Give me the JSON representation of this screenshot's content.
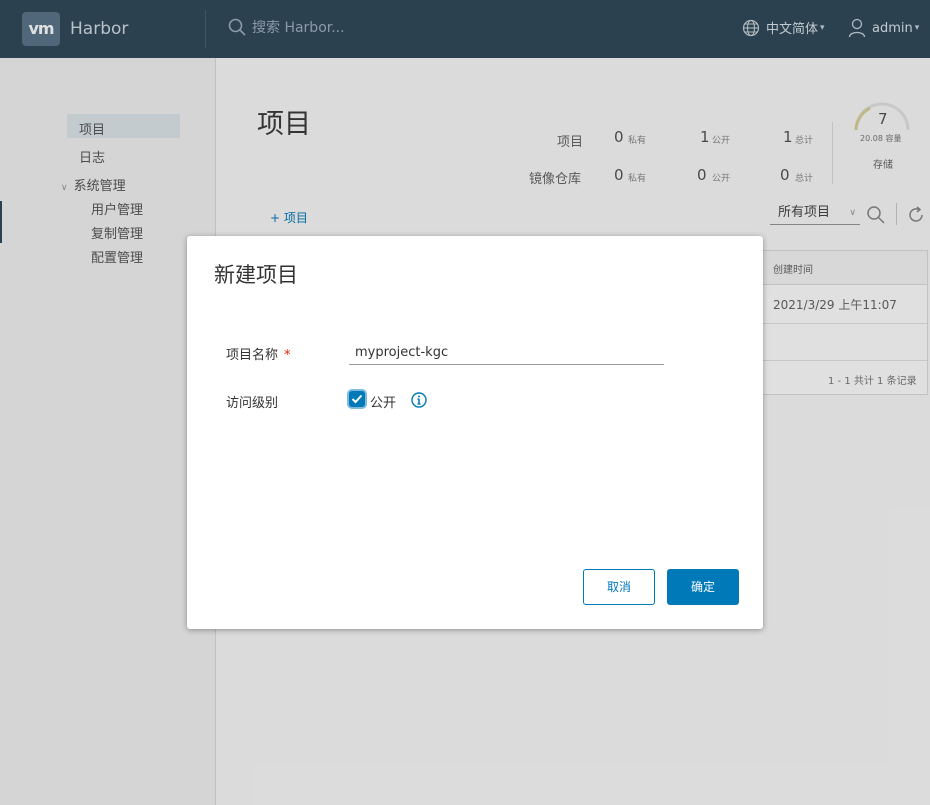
{
  "header": {
    "logo": "vm",
    "app_name": "Harbor",
    "search_placeholder": "搜索 Harbor...",
    "language": "中文简体",
    "user": "admin"
  },
  "sidebar": {
    "items": [
      {
        "label": "项目"
      },
      {
        "label": "日志"
      },
      {
        "label": "系统管理"
      }
    ],
    "sub_items": [
      {
        "label": "用户管理"
      },
      {
        "label": "复制管理"
      },
      {
        "label": "配置管理"
      }
    ]
  },
  "main": {
    "title": "项目",
    "stats": {
      "row1_label": "项目",
      "row2_label": "镜像仓库",
      "row1": [
        {
          "num": "0",
          "unit": "私有"
        },
        {
          "num": "1",
          "unit": "公开"
        },
        {
          "num": "1",
          "unit": "总计"
        }
      ],
      "row2": [
        {
          "num": "0",
          "unit": "私有"
        },
        {
          "num": "0",
          "unit": "公开"
        },
        {
          "num": "0",
          "unit": "总计"
        }
      ],
      "storage_value": "7",
      "storage_sub": "20.08 容量",
      "storage_label": "存储"
    },
    "add_project": "+ 项目",
    "filter_value": "所有项目",
    "table": {
      "column_header": "创建时间",
      "row_value": "2021/3/29 上午11:07",
      "pagination": "1 - 1 共计 1 条记录"
    }
  },
  "modal": {
    "title": "新建项目",
    "name_label": "项目名称",
    "required_mark": "*",
    "name_value": "myproject-kgc",
    "access_label": "访问级别",
    "public_label": "公开",
    "public_checked": true,
    "cancel_label": "取消",
    "ok_label": "确定"
  },
  "colors": {
    "header_bg": "#314a5c",
    "accent": "#0079b8"
  }
}
